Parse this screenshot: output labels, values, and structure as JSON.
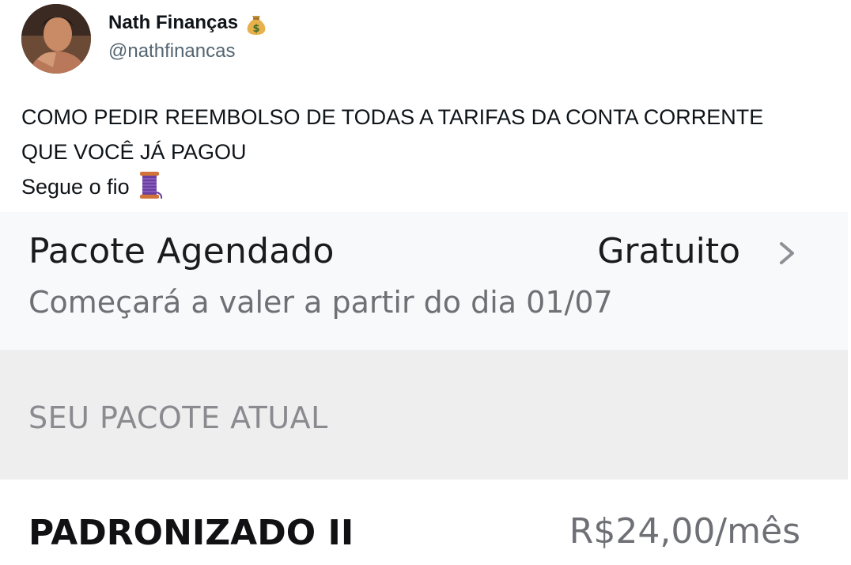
{
  "tweet": {
    "author_name": "Nath Finanças",
    "author_handle": "@nathfinancas",
    "name_emoji_icon": "money-bag-icon",
    "text_lines": [
      "COMO PEDIR REEMBOLSO DE TODAS A TARIFAS DA CONTA CORRENTE",
      "QUE VOCÊ JÁ PAGOU",
      "Segue o fio"
    ],
    "thread_emoji_icon": "spool-of-thread-icon"
  },
  "screenshot": {
    "scheduled_package": {
      "title": "Pacote Agendado",
      "value": "Gratuito",
      "subtitle": "Começará a valer a partir do dia 01/07"
    },
    "section_label": "SEU PACOTE ATUAL",
    "current_package": {
      "name": "PADRONIZADO II",
      "price": "R$24,00/mês"
    }
  },
  "colors": {
    "text_primary": "#0f1419",
    "text_secondary": "#536471",
    "section_bg": "#eeeeef",
    "muted_text": "#8b8b8f"
  }
}
